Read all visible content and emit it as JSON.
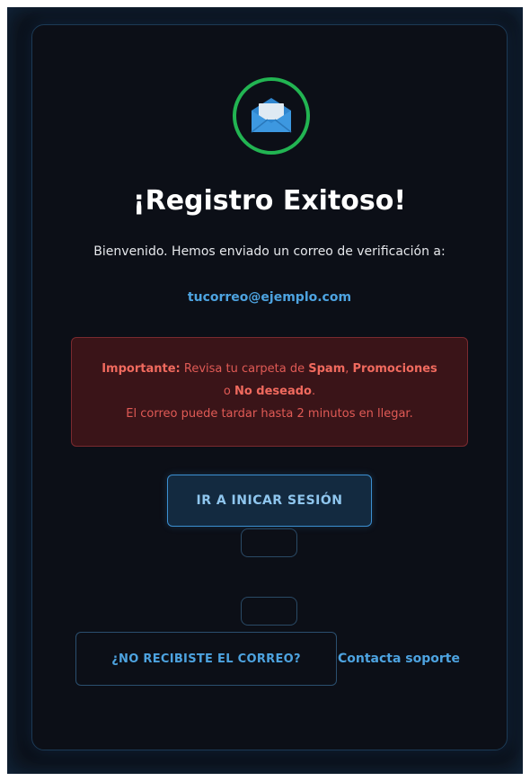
{
  "header": {
    "title": "¡Registro Exitoso!",
    "subtitle": "Bienvenido. Hemos enviado un correo de verificación a:",
    "email": "tucorreo@ejemplo.com",
    "icon": "envelope-icon"
  },
  "alert": {
    "label": "Importante:",
    "text1": " Revisa tu carpeta de ",
    "spam": "Spam",
    "sep": ", ",
    "promo": "Promociones",
    "text2": "o ",
    "nodeseado": "No deseado",
    "period": ".",
    "line3": "El correo puede tardar hasta 2 minutos en llegar."
  },
  "actions": {
    "login_label": "IR A INICAR SESIÓN",
    "resend_label": "¿NO RECIBISTE EL CORREO?",
    "support_label": "Contacta soporte"
  },
  "colors": {
    "accent": "#4da3e0",
    "success": "#22b452",
    "danger": "#e05a55"
  }
}
